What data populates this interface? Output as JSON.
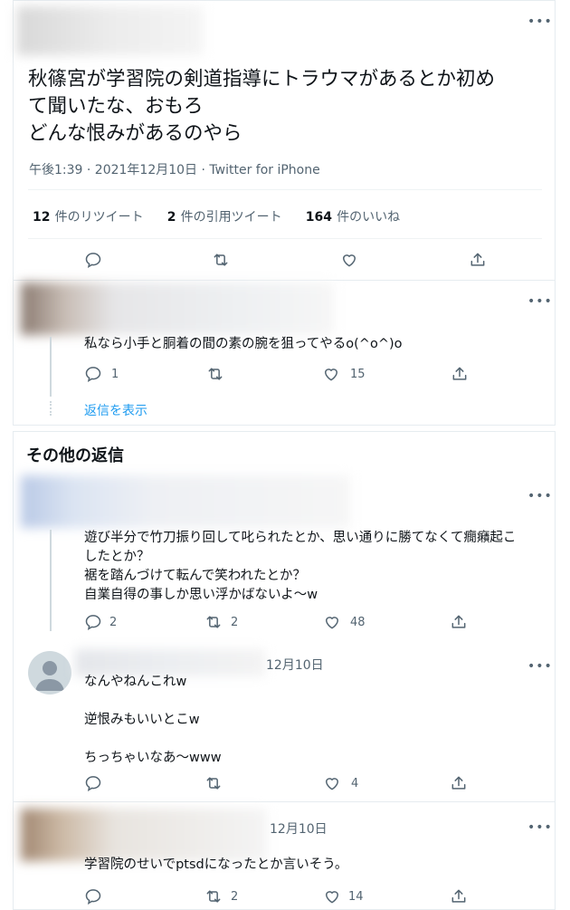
{
  "main_tweet": {
    "text": "秋篠宮が学習院の剣道指導にトラウマがあるとか初め\nて聞いたな、おもろ\nどんな恨みがあるのやら",
    "meta": "午後1:39 · 2021年12月10日 · Twitter for iPhone",
    "stats": {
      "retweets_count": "12",
      "retweets_label": "件のリツイート",
      "quotes_count": "2",
      "quotes_label": "件の引用ツイート",
      "likes_count": "164",
      "likes_label": "件のいいね"
    },
    "more": "•••"
  },
  "reply1": {
    "text": "私なら小手と胴着の間の素の腕を狙ってやるo(^o^)o",
    "replies": "1",
    "likes": "15",
    "show_replies": "返信を表示",
    "more": "•••"
  },
  "section_title": "その他の返信",
  "reply2": {
    "text": "遊び半分で竹刀振り回して叱られたとか、思い通りに勝てなくて癇癪起こ\nしたとか？\n裾を踏んづけて転んで笑われたとか？\n自業自得の事しか思い浮かばないよ〜w",
    "replies": "2",
    "retweets": "2",
    "likes": "48",
    "more": "•••"
  },
  "reply3": {
    "date": "12月10日",
    "text": "なんやねんこれw\n\n逆恨みもいいとこw\n\nちっちゃいなあ〜www",
    "likes": "4",
    "more": "•••"
  },
  "reply4": {
    "date": "12月10日",
    "text": "学習院のせいでptsdになったとか言いそう。",
    "retweets": "2",
    "likes": "14",
    "more": "•••"
  },
  "icons": [
    "reply-icon",
    "retweet-icon",
    "like-icon",
    "share-icon",
    "more-icon",
    "avatar-default-icon"
  ],
  "colors": {
    "text": "#0f1419",
    "secondary": "#536471",
    "link": "#1d9bf0",
    "border": "#e6ecf0"
  }
}
